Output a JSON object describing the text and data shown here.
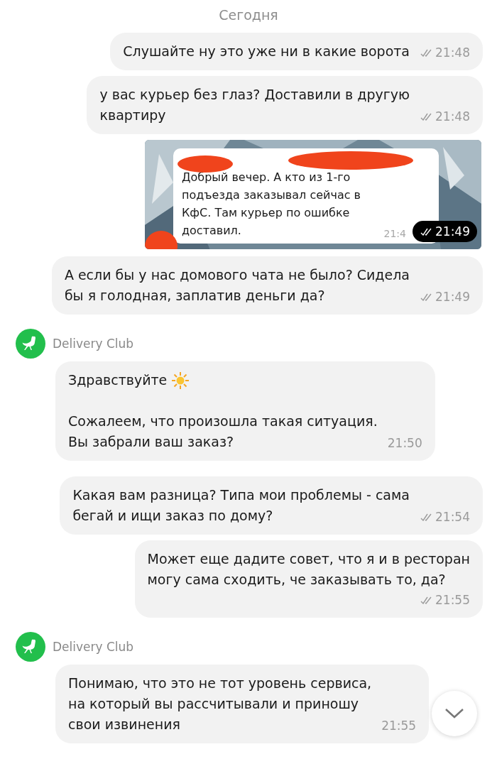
{
  "date_separator": "Сегодня",
  "messages": [
    {
      "kind": "outgoing",
      "text": "Слушайте ну это уже ни в какие ворота",
      "time": "21:48",
      "read": true
    },
    {
      "kind": "outgoing",
      "text": "у вас курьер без глаз? Доставили в другую\nквартиру",
      "time": "21:48",
      "read": true
    },
    {
      "quoted_text": "Добрый вечер. А кто из 1-го\nподъезда заказывал сейчас в\nКфС. Там курьер по ошибке\nдоставил.",
      "quoted_time": "21:4",
      "time": "21:49",
      "read": true
    },
    {
      "kind": "outgoing",
      "text": "А если бы у нас домового чата не было? Сидела\nбы я голодная, заплатив деньги да?",
      "time": "21:49",
      "read": true
    },
    {
      "kind": "incoming",
      "sender": "Delivery Club",
      "paragraphs": [
        "Здравствуйте",
        "Сожалеем, что произошла такая ситуация.\nВы забрали ваш заказ?"
      ],
      "greeting_sun": true,
      "time": "21:50"
    },
    {
      "kind": "outgoing",
      "text": "Какая вам разница? Типа мои проблемы - сама\nбегай и ищи заказ по дому?",
      "time": "21:54",
      "read": true
    },
    {
      "kind": "outgoing",
      "text": "Может еще дадите совет, что я и в ресторан\nмогу сама сходить, че заказывать то, да?",
      "time": "21:55",
      "read": true,
      "time_below": true
    },
    {
      "kind": "incoming",
      "sender": "Delivery Club",
      "paragraphs": [
        "Понимаю, что это не тот уровень сервиса,\nна который вы рассчитывали и приношу\nсвои извинения"
      ],
      "greeting_sun": false,
      "time": "21:55"
    }
  ]
}
